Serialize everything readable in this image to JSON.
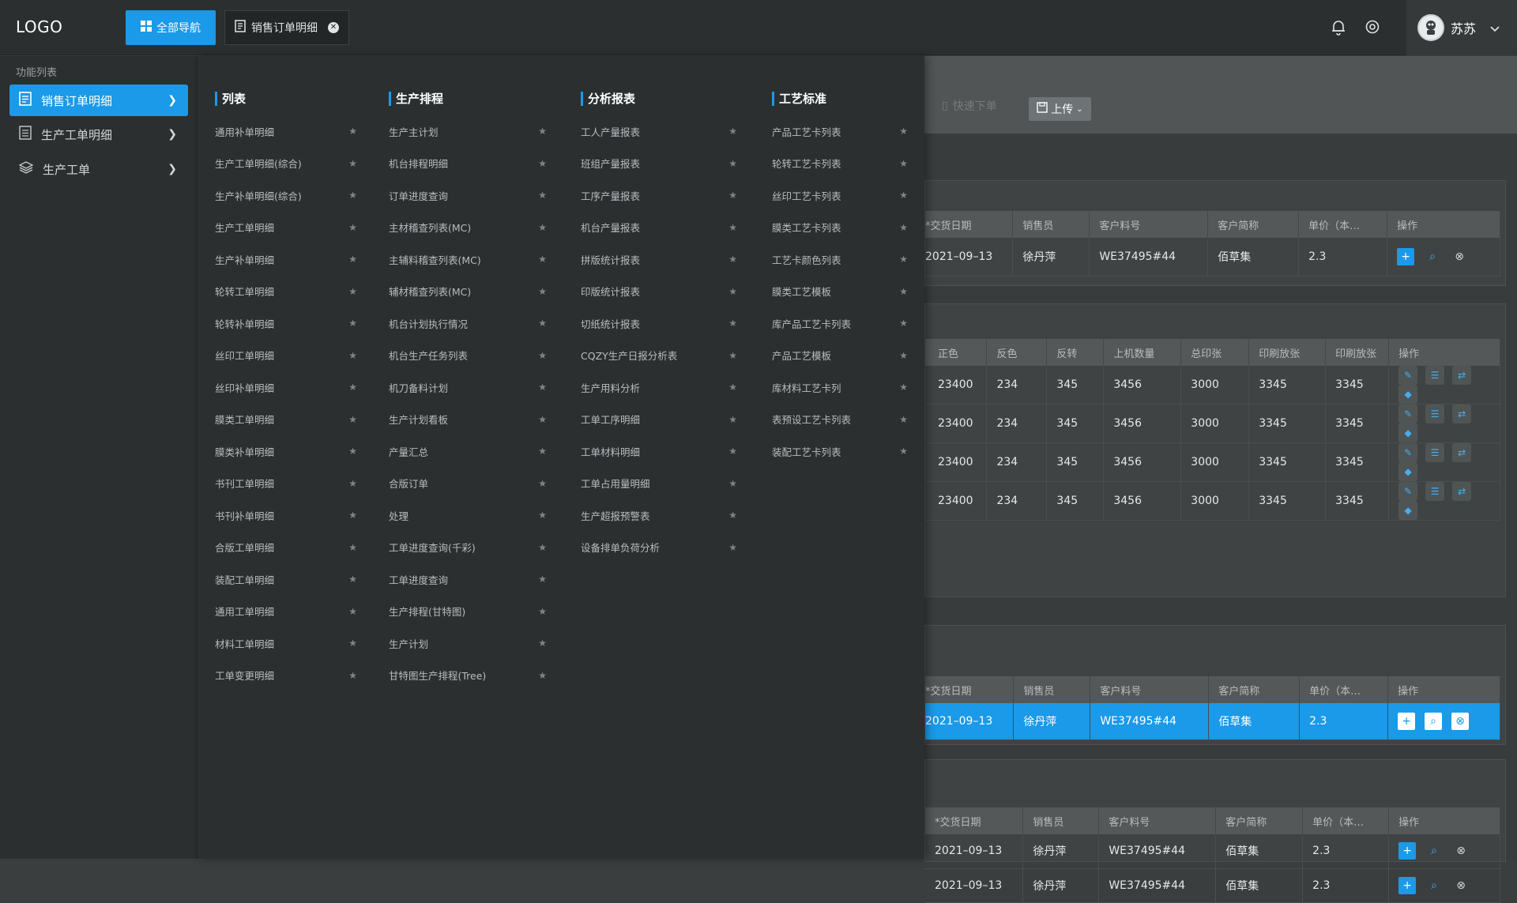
{
  "topbar": {
    "logo": "LOGO",
    "nav_button": "全部导航",
    "tab": "销售订单明细",
    "user_name": "苏苏",
    "icons": [
      "bell-icon",
      "settings-icon",
      "chevron-down-icon"
    ]
  },
  "sidebar": {
    "title": "功能列表",
    "items": [
      {
        "label": "销售订单明细",
        "icon": "document-icon"
      },
      {
        "label": "生产工单明细",
        "icon": "list-icon"
      },
      {
        "label": "生产工单",
        "icon": "layers-icon"
      }
    ]
  },
  "mega_menu": {
    "columns": [
      {
        "title": "列表",
        "items": [
          "通用补单明细",
          "生产工单明细(综合)",
          "生产补单明细(综合)",
          "生产工单明细",
          "生产补单明细",
          "轮转工单明细",
          "轮转补单明细",
          "丝印工单明细",
          "丝印补单明细",
          "膜类工单明细",
          "膜类补单明细",
          "书刊工单明细",
          "书刊补单明细",
          "合版工单明细",
          "装配工单明细",
          "通用工单明细",
          "材料工单明细",
          "工单变更明细"
        ]
      },
      {
        "title": "生产排程",
        "items": [
          "生产主计划",
          "机台排程明细",
          "订单进度查询",
          "主材稽查列表(MC)",
          "主辅料稽查列表(MC)",
          "辅材稽查列表(MC)",
          "机台计划执行情况",
          "机台生产任务列表",
          "机刀备料计划",
          "生产计划看板",
          "产量汇总",
          "合版订单",
          "处理",
          "工单进度查询(千彩)",
          "工单进度查询",
          "生产排程(甘特图)",
          "生产计划",
          "甘特图生产排程(Tree)"
        ]
      },
      {
        "title": "分析报表",
        "items": [
          "工人产量报表",
          "班组产量报表",
          "工序产量报表",
          "机台产量报表",
          "拼版统计报表",
          "印版统计报表",
          "切纸统计报表",
          "CQZY生产日报分析表",
          "生产用料分析",
          "工单工序明细",
          "工单材料明细",
          "工单占用量明细",
          "生产超报预警表",
          "设备排单负荷分析"
        ]
      },
      {
        "title": "工艺标准",
        "items": [
          "产品工艺卡列表",
          "轮转工艺卡列表",
          "丝印工艺卡列表",
          "膜类工艺卡列表",
          "工艺卡颜色列表",
          "膜类工艺模板",
          "库产品工艺卡列表",
          "产品工艺模板",
          "库材料工艺卡列",
          "表预设工艺卡列表",
          "装配工艺卡列表"
        ]
      }
    ]
  },
  "toolbar": {
    "quick_order": "快速下单",
    "upload": "上传"
  },
  "order_table": {
    "headers": [
      "*交货日期",
      "销售员",
      "客户料号",
      "客户简称",
      "单价（本…",
      "操作"
    ],
    "row": [
      "2021–09–13",
      "徐丹萍",
      "WE37495#44",
      "佰草集",
      "2.3"
    ]
  },
  "print_table": {
    "headers": [
      "正色",
      "反色",
      "反转",
      "上机数量",
      "总印张",
      "印刷放张",
      "印刷放张",
      "操作"
    ],
    "rows": [
      [
        "23400",
        "234",
        "345",
        "3456",
        "3000",
        "3345",
        "3345"
      ],
      [
        "23400",
        "234",
        "345",
        "3456",
        "3000",
        "3345",
        "3345"
      ],
      [
        "23400",
        "234",
        "345",
        "3456",
        "3000",
        "3345",
        "3345"
      ],
      [
        "23400",
        "234",
        "345",
        "3456",
        "3000",
        "3345",
        "3345"
      ]
    ]
  },
  "colors": {
    "accent": "#1a9ae8",
    "panel": "#2b2f30",
    "background": "#3a3e3f"
  }
}
